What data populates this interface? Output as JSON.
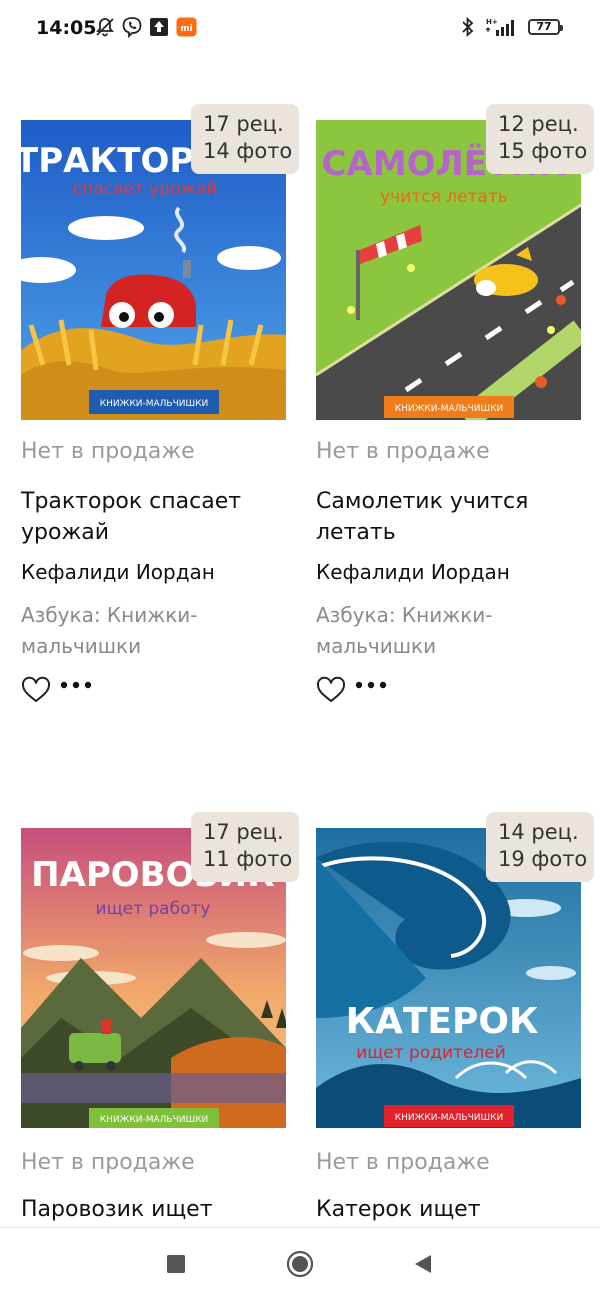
{
  "status_bar": {
    "time": "14:05",
    "battery": "77"
  },
  "books": [
    {
      "title": "Тракторок спасает урожай",
      "author": "Кефалиди Иордан",
      "series": "Азбука: Книжки-мальчишки",
      "availability": "Нет в продаже",
      "reviews": "17 рец.",
      "photos": "14 фото",
      "cover_title": "ТРАКТОРОК",
      "cover_subtitle": "спасает урожай",
      "cover_series": "КНИЖКИ-МАЛЬЧИШКИ"
    },
    {
      "title": "Самолетик учится летать",
      "author": "Кефалиди Иордан",
      "series": "Азбука: Книжки-мальчишки",
      "availability": "Нет в продаже",
      "reviews": "12 рец.",
      "photos": "15 фото",
      "cover_title": "САМОЛЁТИК",
      "cover_subtitle": "учится летать",
      "cover_series": "КНИЖКИ-МАЛЬЧИШКИ"
    },
    {
      "title": "Паровозик ищет",
      "availability": "Нет в продаже",
      "reviews": "17 рец.",
      "photos": "11 фото",
      "cover_title": "ПАРОВОЗИК",
      "cover_subtitle": "ищет работу",
      "cover_series": "КНИЖКИ-МАЛЬЧИШКИ"
    },
    {
      "title": "Катерок ищет",
      "availability": "Нет в продаже",
      "reviews": "14 рец.",
      "photos": "19 фото",
      "cover_title": "КАТЕРОК",
      "cover_subtitle": "ищет родителей",
      "cover_series": "КНИЖКИ-МАЛЬЧИШКИ"
    }
  ],
  "icons": {
    "favorite": "heart-outline-icon",
    "more": "more-dots-icon",
    "nav_recents": "square-icon",
    "nav_home": "circle-icon",
    "nav_back": "triangle-back-icon"
  }
}
